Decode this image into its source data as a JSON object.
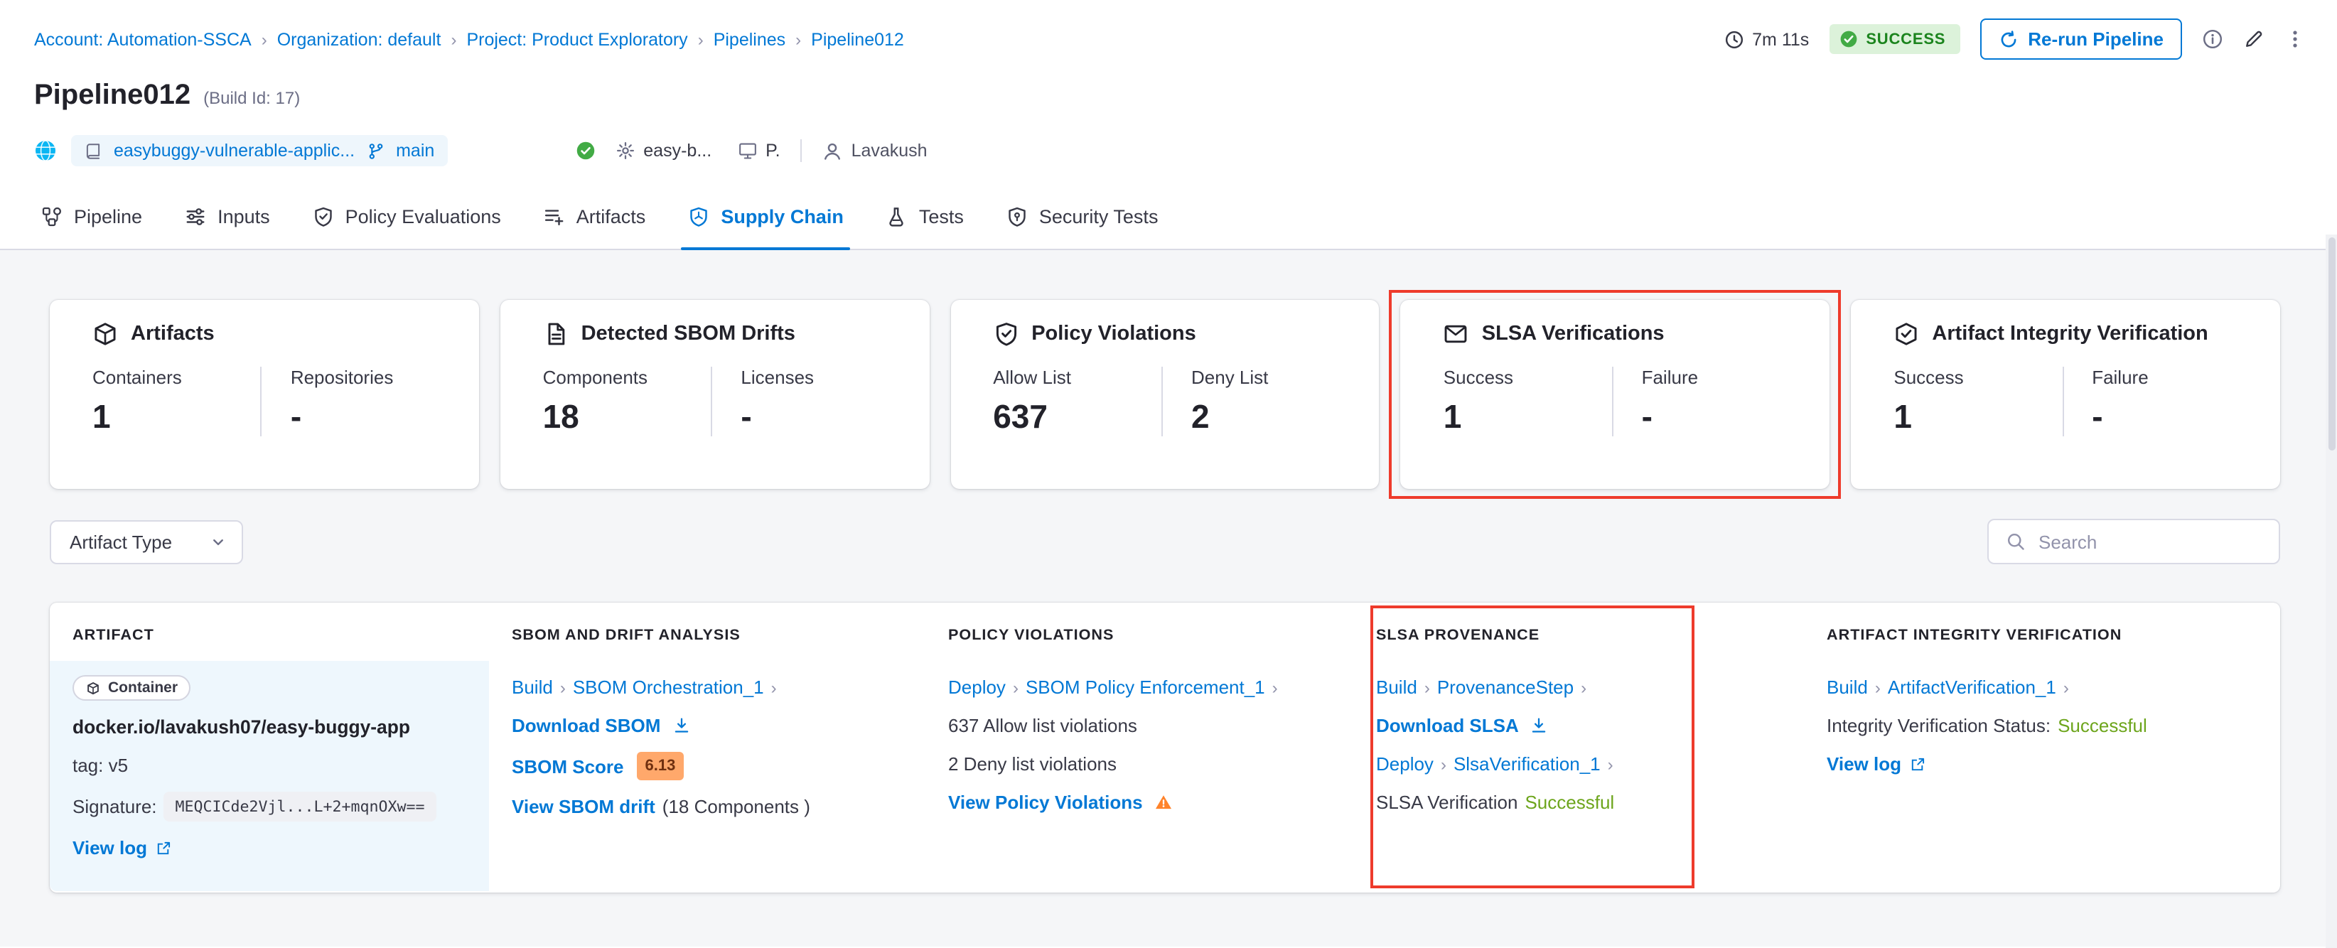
{
  "misc": {
    "chevron": "›"
  },
  "colors": {
    "accent_blue": "#0278d5",
    "success_badge_green": "#1b841d",
    "success_text_green": "#6da51c",
    "annotation_red": "#ee3b2c",
    "warning_orange": "#ff832b",
    "score_badge_orange": "#ffa86b"
  },
  "breadcrumb": {
    "separator": "›",
    "items": [
      "Account: Automation-SSCA",
      "Organization: default",
      "Project: Product Exploratory",
      "Pipelines",
      "Pipeline012"
    ]
  },
  "topbar": {
    "duration": "7m 11s",
    "status": "SUCCESS",
    "rerun_label": "Re-run Pipeline"
  },
  "page": {
    "title": "Pipeline012",
    "build_id": "(Build Id: 17)"
  },
  "meta": {
    "repo_name": "easybuggy-vulnerable-applic...",
    "branch": "main",
    "service": "easy-b...",
    "environment": "P.",
    "user": "Lavakush"
  },
  "tabs": {
    "active": "Supply Chain",
    "items": [
      "Pipeline",
      "Inputs",
      "Policy Evaluations",
      "Artifacts",
      "Supply Chain",
      "Tests",
      "Security Tests"
    ]
  },
  "summary_cards": [
    {
      "title": "Artifacts",
      "col1_label": "Containers",
      "col1_value": "1",
      "col2_label": "Repositories",
      "col2_value": "-"
    },
    {
      "title": "Detected SBOM Drifts",
      "col1_label": "Components",
      "col1_value": "18",
      "col2_label": "Licenses",
      "col2_value": "-"
    },
    {
      "title": "Policy Violations",
      "col1_label": "Allow List",
      "col1_value": "637",
      "col2_label": "Deny List",
      "col2_value": "2"
    },
    {
      "title": "SLSA Verifications",
      "col1_label": "Success",
      "col1_value": "1",
      "col2_label": "Failure",
      "col2_value": "-",
      "highlighted": true
    },
    {
      "title": "Artifact Integrity Verification",
      "col1_label": "Success",
      "col1_value": "1",
      "col2_label": "Failure",
      "col2_value": "-"
    }
  ],
  "filters": {
    "artifact_type_label": "Artifact Type",
    "search_placeholder": "Search"
  },
  "table": {
    "headers": [
      "ARTIFACT",
      "SBOM AND DRIFT ANALYSIS",
      "POLICY VIOLATIONS",
      "SLSA PROVENANCE",
      "ARTIFACT INTEGRITY VERIFICATION"
    ],
    "row": {
      "artifact": {
        "type_chip": "Container",
        "image": "docker.io/lavakush07/easy-buggy-app",
        "tag": "tag: v5",
        "signature_label": "Signature:",
        "signature_value": "MEQCICde2Vjl...L+2+mqnOXw==",
        "view_log": "View log"
      },
      "sbom": {
        "stage": "Build",
        "step": "SBOM Orchestration_1",
        "download": "Download SBOM",
        "score_label": "SBOM Score",
        "score_value": "6.13",
        "drift_link": "View SBOM drift",
        "drift_suffix": "(18 Components )"
      },
      "policy": {
        "stage": "Deploy",
        "step": "SBOM Policy Enforcement_1",
        "allow": "637 Allow list violations",
        "deny": "2 Deny list violations",
        "view": "View Policy Violations"
      },
      "slsa": {
        "stage1": "Build",
        "step1": "ProvenanceStep",
        "download": "Download SLSA",
        "stage2": "Deploy",
        "step2": "SlsaVerification_1",
        "status_prefix": "SLSA Verification",
        "status_value": "Successful"
      },
      "integrity": {
        "stage": "Build",
        "step": "ArtifactVerification_1",
        "status_prefix": "Integrity Verification Status:",
        "status_value": "Successful",
        "view_log": "View log"
      }
    }
  }
}
